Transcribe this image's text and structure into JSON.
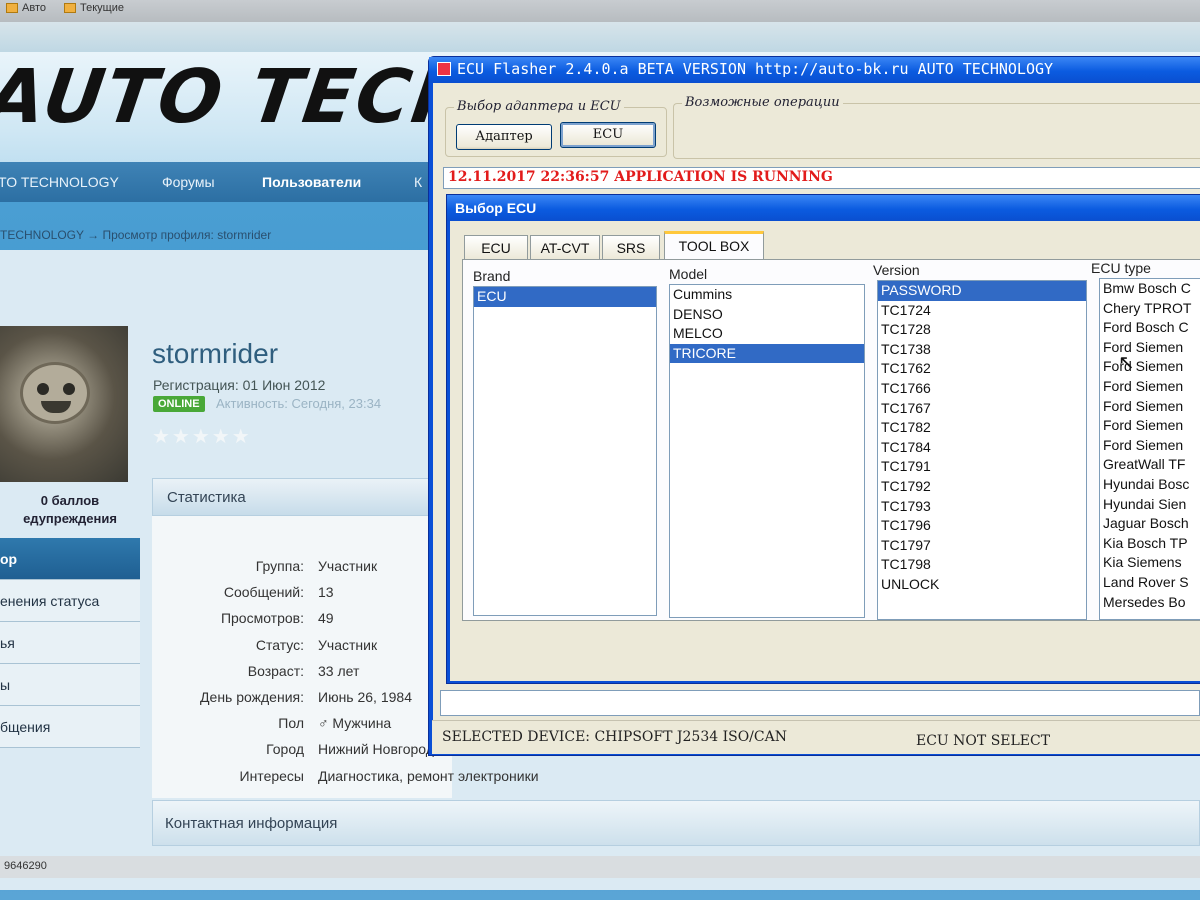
{
  "browser": {
    "bookmarks": [
      "Авто",
      "Текущие"
    ]
  },
  "site": {
    "logo": "AUTO TECH",
    "nav": [
      "TO TECHNOLOGY",
      "Форумы",
      "Пользователи",
      "К"
    ],
    "breadcrumb": "TECHNOLOGY  →  Просмотр профиля: stormrider",
    "profile": {
      "name": "stormrider",
      "registration": "Регистрация: 01 Июн 2012",
      "online": "ONLINE",
      "activity": "Активность: Сегодня, 23:34",
      "stars": "★★★★★",
      "points": "0 баллов",
      "warnings": "едупреждения"
    },
    "left_menu": [
      "ор",
      "енения статуса",
      "ья",
      "ы",
      "бщения"
    ],
    "stats": {
      "title": "Статистика",
      "rows": [
        {
          "k": "Группа:",
          "v": "Участник"
        },
        {
          "k": "Сообщений:",
          "v": "13"
        },
        {
          "k": "Просмотров:",
          "v": "49"
        },
        {
          "k": "Статус:",
          "v": "Участник"
        },
        {
          "k": "Возраст:",
          "v": "33 лет"
        },
        {
          "k": "День рождения:",
          "v": "Июнь 26, 1984"
        },
        {
          "k": "Пол",
          "v": "Мужчина"
        },
        {
          "k": "Город",
          "v": "Нижний Новгород"
        },
        {
          "k": "Интересы",
          "v": "Диагностика, ремонт электроники"
        }
      ]
    },
    "contact_title": "Контактная информация",
    "taskbar_text": "9646290"
  },
  "app": {
    "title": "ECU Flasher 2.4.0.a BETA VERSION  http://auto-bk.ru  AUTO TECHNOLOGY",
    "group_adapter": "Выбор адаптера и ECU",
    "group_ops": "Возможные операции",
    "btn_adapter": "Адаптер",
    "btn_ecu": "ECU",
    "log": "12.11.2017 22:36:57 APPLICATION IS RUNNING",
    "status_left": "SELECTED DEVICE: CHIPSOFT J2534 ISO/CAN",
    "status_right": "ECU NOT SELECT"
  },
  "dialog": {
    "title": "Выбор ECU",
    "tabs": [
      "ECU",
      "AT-CVT",
      "SRS",
      "TOOL BOX"
    ],
    "active_tab": "TOOL BOX",
    "columns": {
      "brand": "Brand",
      "model": "Model",
      "version": "Version",
      "ecu_type": "ECU type"
    },
    "brand_items": [
      "ECU"
    ],
    "brand_selected": "ECU",
    "model_items": [
      "Cummins",
      "DENSO",
      "MELCO",
      "TRICORE"
    ],
    "model_selected": "TRICORE",
    "version_items": [
      "PASSWORD",
      "TC1724",
      "TC1728",
      "TC1738",
      "TC1762",
      "TC1766",
      "TC1767",
      "TC1782",
      "TC1784",
      "TC1791",
      "TC1792",
      "TC1793",
      "TC1796",
      "TC1797",
      "TC1798",
      "UNLOCK"
    ],
    "version_selected": "PASSWORD",
    "ecu_type_items": [
      "Bmw Bosch C",
      "Chery TPROT",
      "Ford Bosch C",
      "Ford Siemen",
      "Ford Siemen",
      "Ford Siemen",
      "Ford Siemen",
      "Ford Siemen",
      "Ford Siemen",
      "GreatWall TF",
      "Hyundai Bosc",
      "Hyundai Sien",
      "Jaguar Bosch",
      "Kia Bosch TP",
      "Kia Siemens",
      "Land Rover S",
      "Mersedes Bo"
    ]
  }
}
